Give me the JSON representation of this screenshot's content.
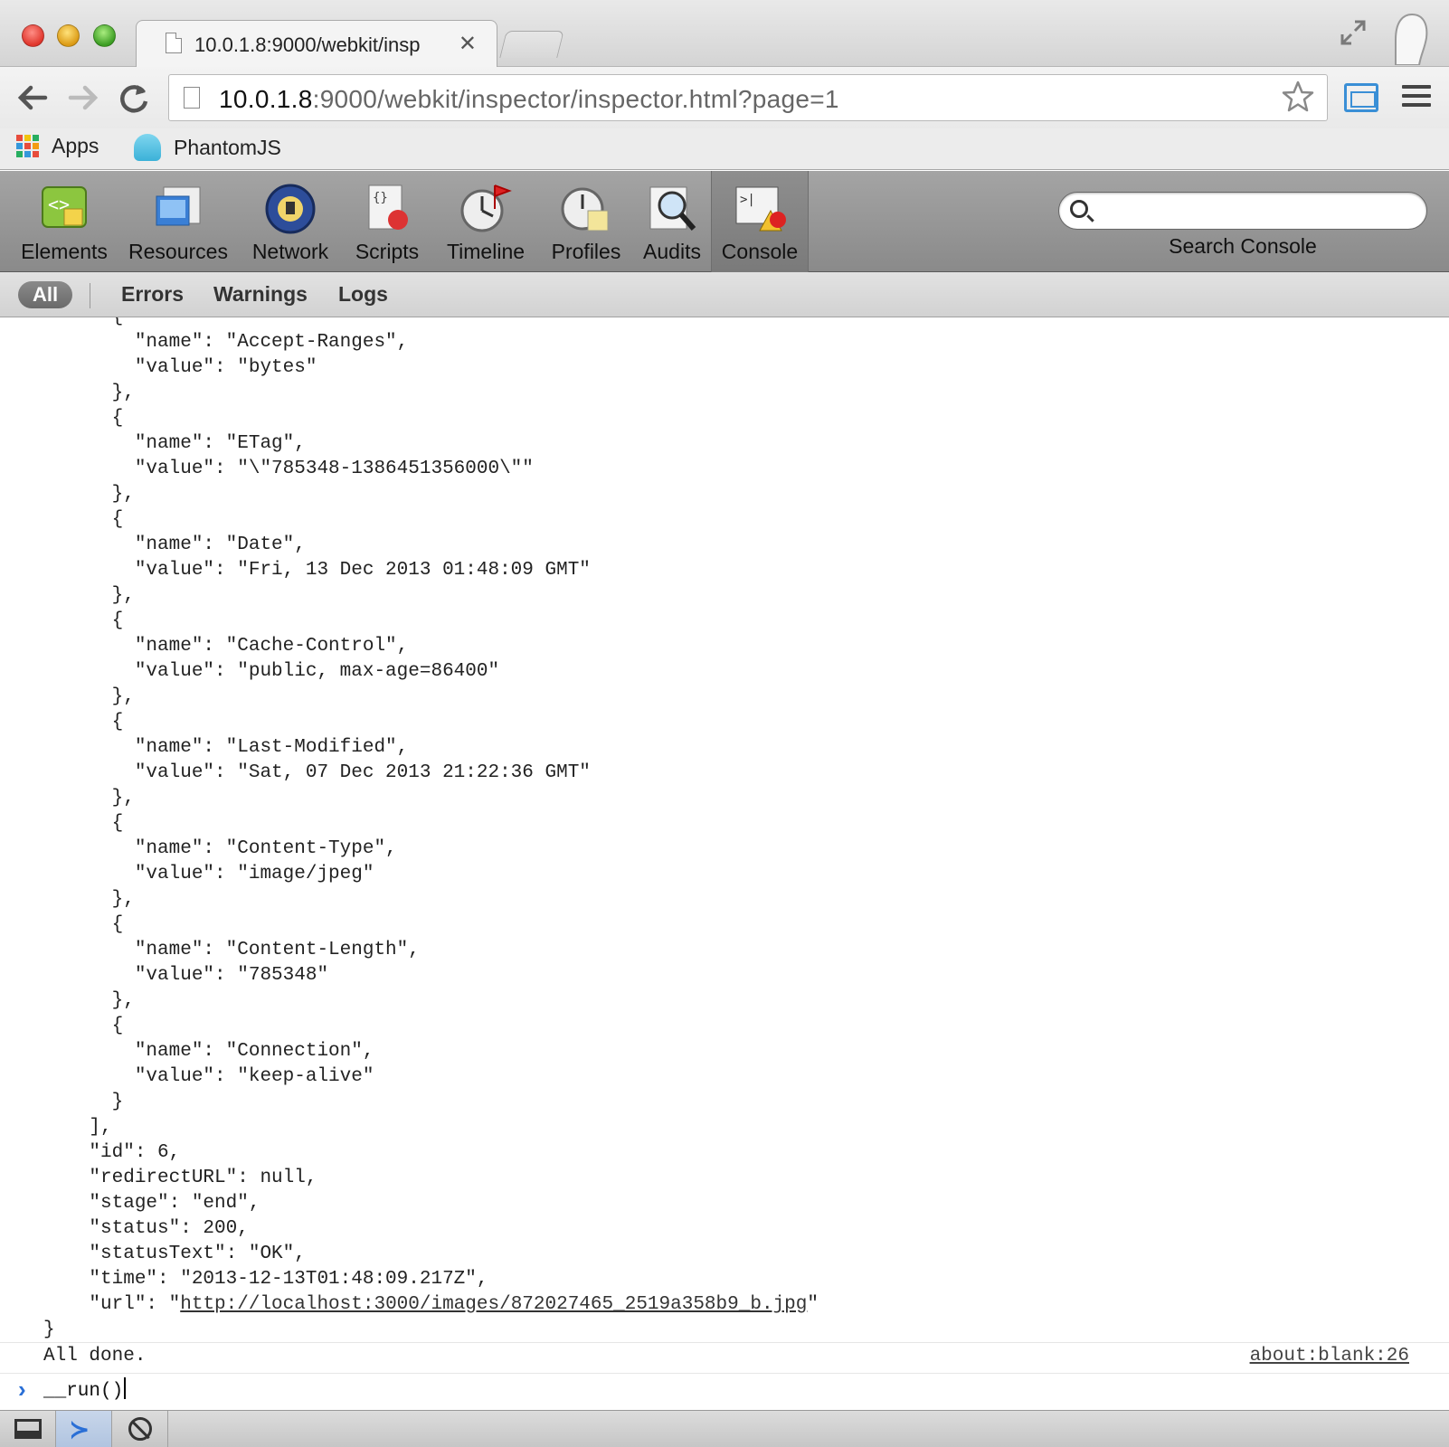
{
  "tab": {
    "title": "10.0.1.8:9000/webkit/insp",
    "close": "✕"
  },
  "address": {
    "host": "10.0.1.8",
    "path": ":9000/webkit/inspector/inspector.html?page=1"
  },
  "bookmarks": [
    {
      "label": "Apps",
      "icon": "apps-grid-icon"
    },
    {
      "label": "PhantomJS",
      "icon": "phantomjs-ghost-icon"
    }
  ],
  "inspector": {
    "panels": [
      {
        "label": "Elements",
        "icon": "elements-icon"
      },
      {
        "label": "Resources",
        "icon": "resources-icon"
      },
      {
        "label": "Network",
        "icon": "network-icon"
      },
      {
        "label": "Scripts",
        "icon": "scripts-icon"
      },
      {
        "label": "Timeline",
        "icon": "timeline-icon"
      },
      {
        "label": "Profiles",
        "icon": "profiles-icon"
      },
      {
        "label": "Audits",
        "icon": "audits-icon"
      },
      {
        "label": "Console",
        "icon": "console-icon",
        "selected": true
      }
    ],
    "search": {
      "placeholder": "",
      "label": "Search Console"
    },
    "filters": {
      "all": "All",
      "errors": "Errors",
      "warnings": "Warnings",
      "logs": "Logs"
    }
  },
  "console": {
    "lines_before_link": "      {\n        \"name\": \"Accept-Ranges\",\n        \"value\": \"bytes\"\n      },\n      {\n        \"name\": \"ETag\",\n        \"value\": \"\\\"785348-1386451356000\\\"\"\n      },\n      {\n        \"name\": \"Date\",\n        \"value\": \"Fri, 13 Dec 2013 01:48:09 GMT\"\n      },\n      {\n        \"name\": \"Cache-Control\",\n        \"value\": \"public, max-age=86400\"\n      },\n      {\n        \"name\": \"Last-Modified\",\n        \"value\": \"Sat, 07 Dec 2013 21:22:36 GMT\"\n      },\n      {\n        \"name\": \"Content-Type\",\n        \"value\": \"image/jpeg\"\n      },\n      {\n        \"name\": \"Content-Length\",\n        \"value\": \"785348\"\n      },\n      {\n        \"name\": \"Connection\",\n        \"value\": \"keep-alive\"\n      }\n    ],\n    \"id\": 6,\n    \"redirectURL\": null,\n    \"stage\": \"end\",\n    \"status\": 200,\n    \"statusText\": \"OK\",\n    \"time\": \"2013-12-13T01:48:09.217Z\",\n    \"url\": \"",
    "url_link": "http://localhost:3000/images/872027465_2519a358b9_b.jpg",
    "lines_after_link": "\"\n}",
    "message": "All done.",
    "message_source": "about:blank:26",
    "prompt_input": "__run()"
  }
}
